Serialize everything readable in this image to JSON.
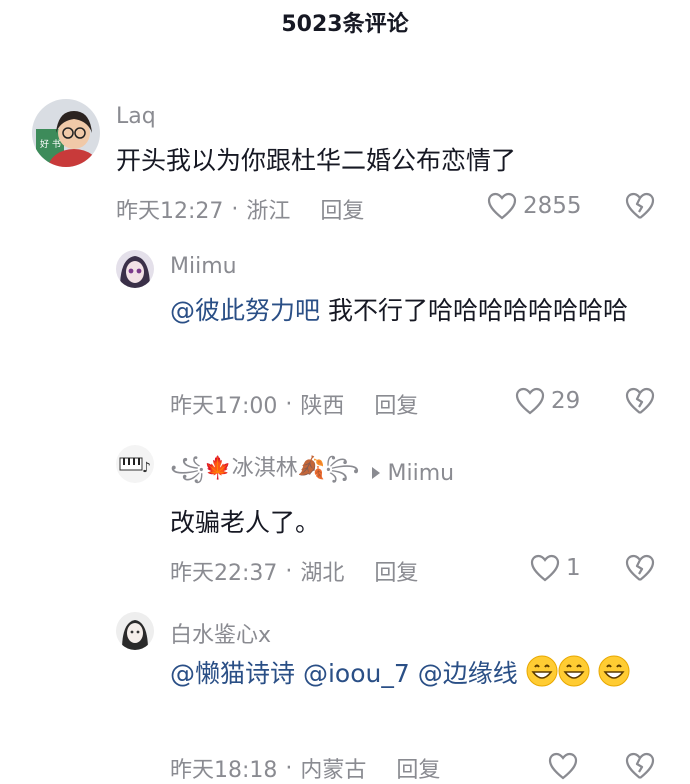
{
  "header": {
    "title": "5023条评论"
  },
  "comments": [
    {
      "username": "Laq",
      "text": "开头我以为你跟杜华二婚公布恋情了",
      "time": "昨天12:27",
      "location": "浙江",
      "reply_label": "回复",
      "likes": "2855"
    },
    {
      "username": "Miimu",
      "mention": "@彼此努力吧",
      "text": " 我不行了哈哈哈哈哈哈哈哈",
      "time": "昨天17:00",
      "location": "陕西",
      "reply_label": "回复",
      "likes": "29"
    },
    {
      "username": "꧁🍁冰淇林🍂꧂",
      "reply_to": "Miimu",
      "text": "改骗老人了。",
      "time": "昨天22:37",
      "location": "湖北",
      "reply_label": "回复",
      "likes": "1"
    },
    {
      "username": "白水鉴心x",
      "mentions": [
        "@懒猫诗诗",
        "@ioou_7",
        "@边缘线"
      ],
      "time": "昨天18:18",
      "location": "内蒙古",
      "reply_label": "回复",
      "emoji": "grinning-emoji"
    }
  ],
  "icons": {
    "like": "heart-outline-icon",
    "dislike": "broken-heart-icon",
    "reply_arrow": "play-arrow-icon"
  },
  "colors": {
    "text": "#161823",
    "muted": "#8a8b91",
    "mention": "#2a4f86"
  }
}
